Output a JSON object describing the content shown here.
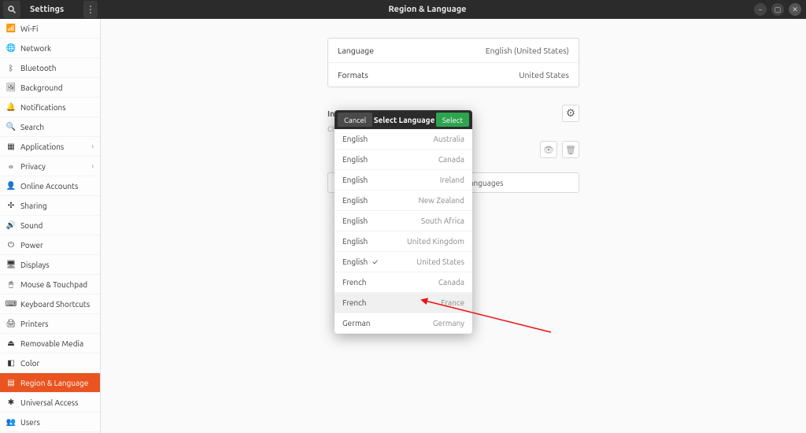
{
  "header": {
    "left_title": "Settings",
    "right_title": "Region & Language"
  },
  "sidebar": {
    "items": [
      {
        "icon": "📶",
        "label": "Wi-Fi",
        "chev": ""
      },
      {
        "icon": "🌐",
        "label": "Network",
        "chev": ""
      },
      {
        "icon": "ᛒ",
        "label": "Bluetooth",
        "chev": ""
      },
      {
        "icon": "🖼",
        "label": "Background",
        "chev": ""
      },
      {
        "icon": "🔔",
        "label": "Notifications",
        "chev": ""
      },
      {
        "icon": "🔍",
        "label": "Search",
        "chev": ""
      },
      {
        "icon": "▦",
        "label": "Applications",
        "chev": "›"
      },
      {
        "icon": "⦵",
        "label": "Privacy",
        "chev": "›"
      },
      {
        "icon": "👤",
        "label": "Online Accounts",
        "chev": ""
      },
      {
        "icon": "✣",
        "label": "Sharing",
        "chev": ""
      },
      {
        "icon": "🔊",
        "label": "Sound",
        "chev": ""
      },
      {
        "icon": "⏻",
        "label": "Power",
        "chev": ""
      },
      {
        "icon": "🖥",
        "label": "Displays",
        "chev": ""
      },
      {
        "icon": "🖱",
        "label": "Mouse & Touchpad",
        "chev": ""
      },
      {
        "icon": "⌨",
        "label": "Keyboard Shortcuts",
        "chev": ""
      },
      {
        "icon": "🖨",
        "label": "Printers",
        "chev": ""
      },
      {
        "icon": "⏏",
        "label": "Removable Media",
        "chev": ""
      },
      {
        "icon": "◧",
        "label": "Color",
        "chev": ""
      },
      {
        "icon": "▤",
        "label": "Region & Language",
        "chev": ""
      },
      {
        "icon": "✱",
        "label": "Universal Access",
        "chev": ""
      },
      {
        "icon": "👥",
        "label": "Users",
        "chev": ""
      }
    ],
    "active_index": 18
  },
  "main": {
    "language_row": {
      "key": "Language",
      "value": "English (United States)"
    },
    "formats_row": {
      "key": "Formats",
      "value": "United States"
    },
    "input_sources_title": "Input Sources",
    "input_sources_sub": "Choose keyboard layouts or input methods.",
    "manage_label": "Manage Installed Languages"
  },
  "dialog": {
    "cancel_label": "Cancel",
    "title": "Select Language",
    "select_label": "Select",
    "rows": [
      {
        "lang": "English",
        "region": "Australia"
      },
      {
        "lang": "English",
        "region": "Canada"
      },
      {
        "lang": "English",
        "region": "Ireland"
      },
      {
        "lang": "English",
        "region": "New Zealand"
      },
      {
        "lang": "English",
        "region": "South Africa"
      },
      {
        "lang": "English",
        "region": "United Kingdom"
      },
      {
        "lang": "English",
        "region": "United States"
      },
      {
        "lang": "French",
        "region": "Canada"
      },
      {
        "lang": "French",
        "region": "France"
      },
      {
        "lang": "German",
        "region": "Germany"
      }
    ],
    "checked_index": 6,
    "hovered_index": 8
  }
}
